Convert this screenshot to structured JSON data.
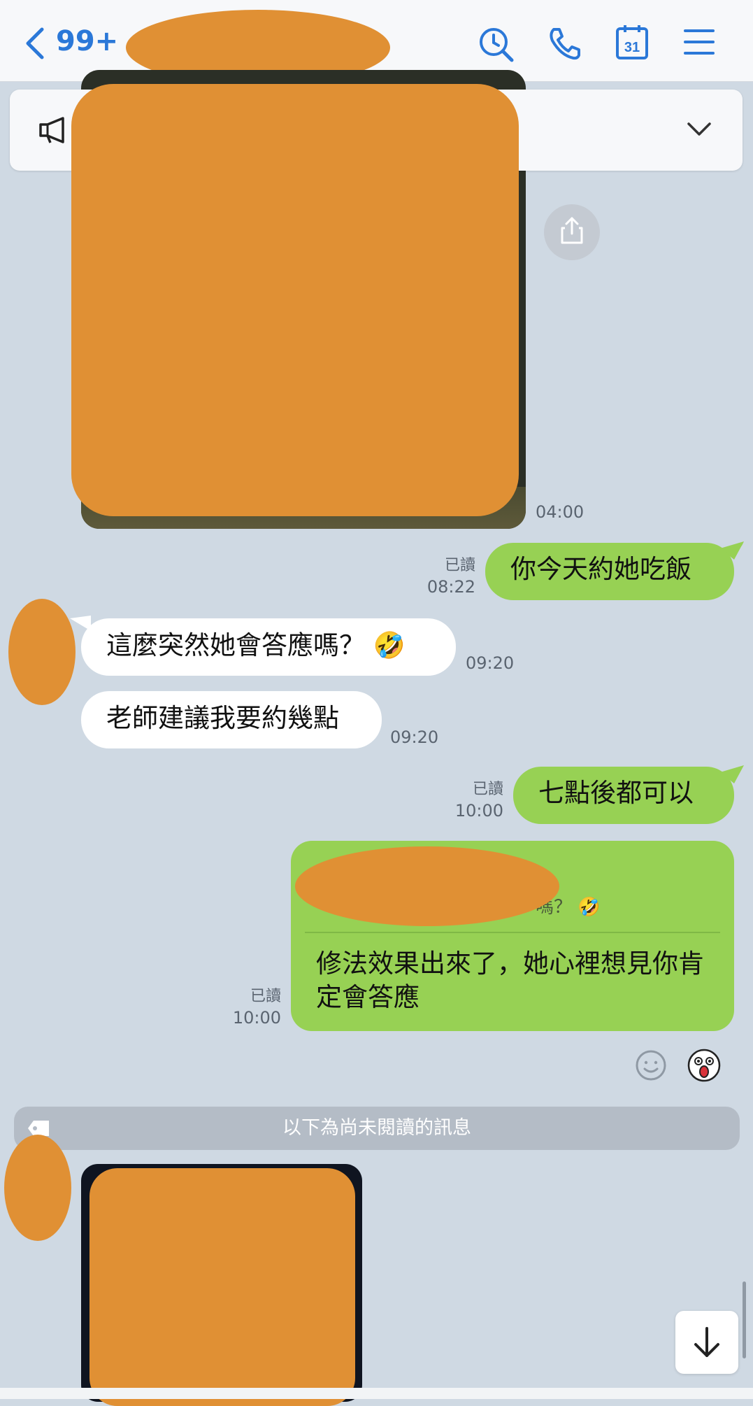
{
  "header": {
    "back_count": "99+",
    "icons": [
      "back-chevron-icon",
      "search-icon",
      "phone-icon",
      "calendar-icon",
      "menu-icon"
    ],
    "calendar_day": "31"
  },
  "announcement": {
    "icons": [
      "megaphone-icon",
      "chevron-down-icon"
    ]
  },
  "messages": [
    {
      "side": "them",
      "type": "photo",
      "time": "04:00"
    },
    {
      "side": "me",
      "text": "你今天約她吃飯",
      "read": "已讀",
      "time": "08:22"
    },
    {
      "side": "them",
      "text": "這麼突然她會答應嗎？ 🤣",
      "time": "09:20"
    },
    {
      "side": "them",
      "text": "老師建議我要約幾點",
      "time": "09:20"
    },
    {
      "side": "me",
      "text": "七點後都可以",
      "read": "已讀",
      "time": "10:00"
    },
    {
      "side": "me",
      "type": "reply",
      "quoted_text": "嗎？ 🤣",
      "text": "修法效果出來了，她心裡想見你肯定會答應",
      "read": "已讀",
      "time": "10:00"
    }
  ],
  "unread_divider": "以下為尚未閱讀的訊息",
  "colors": {
    "accent": "#2b78d8",
    "my_bubble": "#97d154",
    "background": "#cfd9e3",
    "redaction": "#e09034"
  }
}
